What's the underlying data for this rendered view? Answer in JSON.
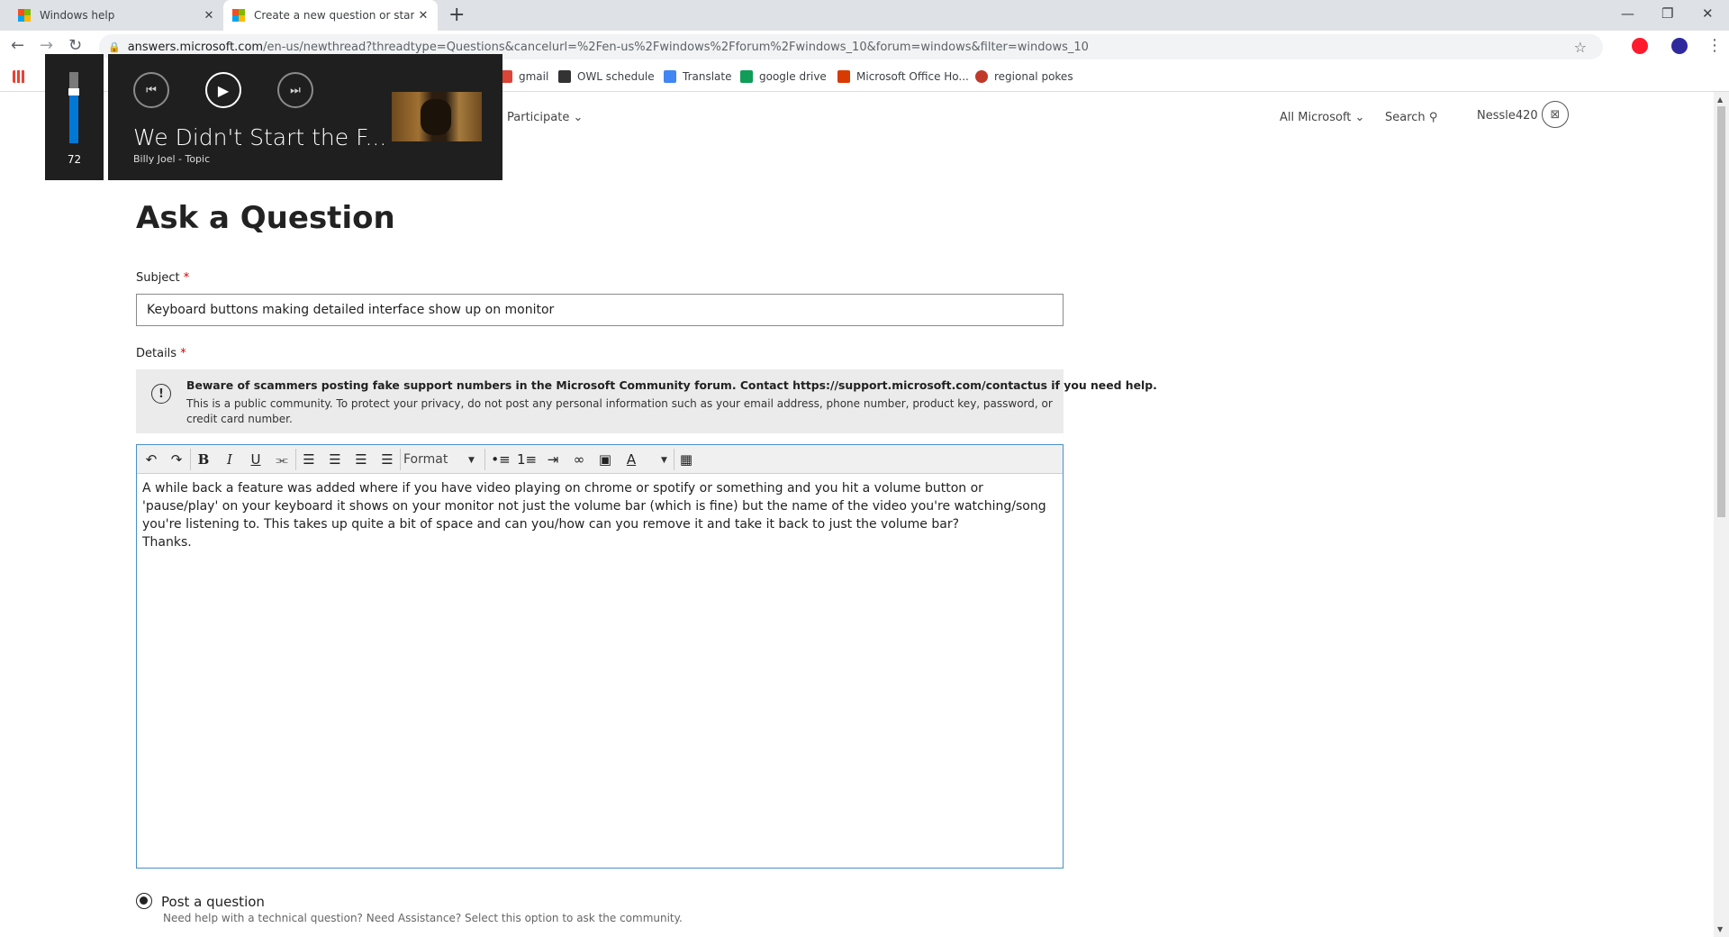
{
  "browser": {
    "tabs": [
      {
        "title": "Windows help"
      },
      {
        "title": "Create a new question or start a"
      }
    ],
    "new_tab": "+",
    "url_host": "answers.microsoft.com",
    "url_path": "/en-us/newthread?threadtype=Questions&cancelurl=%2Fen-us%2Fwindows%2Fforum%2Fwindows_10&forum=windows&filter=windows_10"
  },
  "bookmarks": [
    {
      "label": "gmail",
      "color": "#db4437"
    },
    {
      "label": "OWL schedule",
      "color": "#333333"
    },
    {
      "label": "Translate",
      "color": "#4285f4"
    },
    {
      "label": "google drive",
      "color": "#0f9d58"
    },
    {
      "label": "Microsoft Office Ho...",
      "color": "#d83b01"
    },
    {
      "label": "regional pokes",
      "color": "#c0392b"
    }
  ],
  "header": {
    "participate": "Participate",
    "all_microsoft": "All Microsoft",
    "search": "Search",
    "username": "Nessle420"
  },
  "media_overlay": {
    "volume": "72",
    "volume_level": 0.72,
    "song_title": "We Didn't Start the F...",
    "artist": "Billy Joel - Topic"
  },
  "form": {
    "page_title": "Ask a Question",
    "subject_label": "Subject",
    "required_mark": "*",
    "subject_value": "Keyboard buttons making detailed interface show up on monitor",
    "details_label": "Details",
    "notice_bold": "Beware of scammers posting fake support numbers in the Microsoft Community forum. Contact https://support.microsoft.com/contactus if you need help.",
    "notice_text": "This is a public community. To protect your privacy, do not post any personal information such as your email address, phone number, product key, password, or credit card number.",
    "toolbar": {
      "bold": "B",
      "italic": "I",
      "underline": "U",
      "format": "Format"
    },
    "body_paragraph": "A while back a feature was added where if you have video playing on chrome or spotify or something and you hit a volume button or 'pause/play' on your keyboard it shows on your monitor not just the volume bar  (which is fine) but the name of the video you're watching/song you're listening to. This takes up quite a bit of space and can you/how can you remove it and take it back to just the volume bar?",
    "body_thanks": "Thanks.",
    "post_type_label": "Post a question",
    "post_type_desc": "Need help with a technical question? Need Assistance? Select this option to ask the community."
  }
}
